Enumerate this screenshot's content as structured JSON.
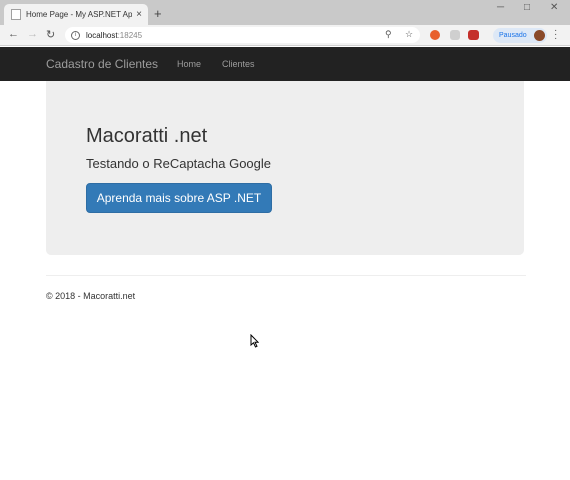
{
  "browser": {
    "tab_title": "Home Page - My ASP.NET Appli",
    "tab_close": "×",
    "new_tab": "+",
    "url_host": "localhost",
    "url_port": ":18245",
    "profile_label": "Pausado",
    "controls": {
      "minimize": "─",
      "maximize": "□",
      "close": "✕"
    }
  },
  "navbar": {
    "brand": "Cadastro de Clientes",
    "links": [
      "Home",
      "Clientes"
    ]
  },
  "jumbotron": {
    "title": "Macoratti .net",
    "subtitle": "Testando o ReCaptacha Google",
    "button_label": "Aprenda mais sobre ASP .NET"
  },
  "footer": {
    "text": "© 2018 - Macoratti.net"
  },
  "colors": {
    "navbar_bg": "#222222",
    "primary_button": "#337ab7",
    "jumbotron_bg": "#eeeeee"
  }
}
